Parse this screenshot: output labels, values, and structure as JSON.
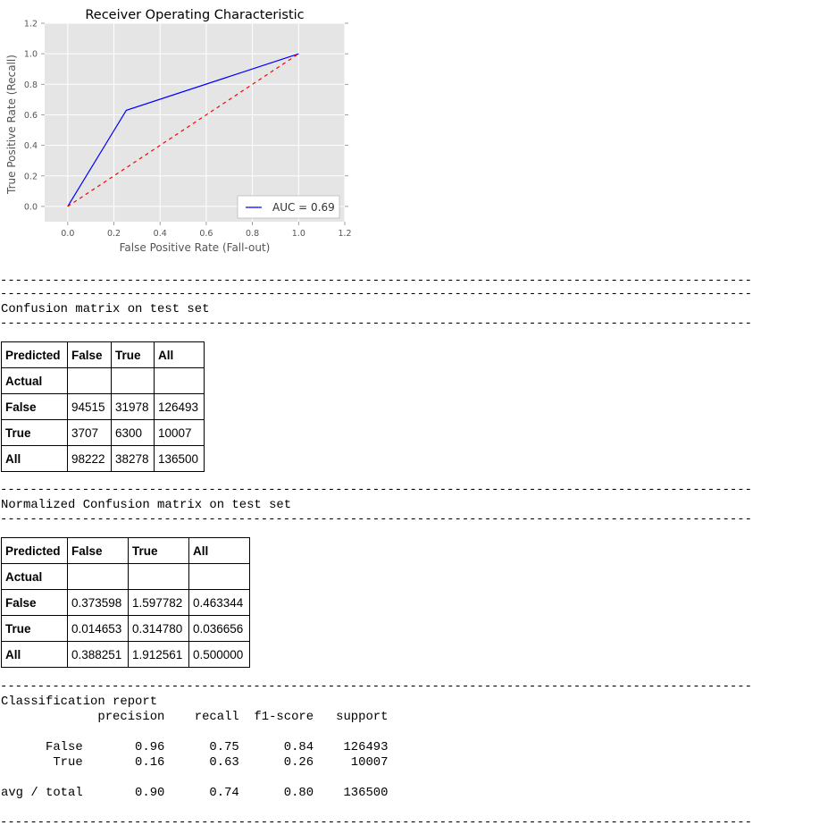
{
  "chart_data": {
    "type": "line",
    "title": "Receiver Operating Characteristic",
    "xlabel": "False Positive Rate (Fall-out)",
    "ylabel": "True Positive Rate (Recall)",
    "xlim": [
      -0.1,
      1.2
    ],
    "ylim": [
      -0.1,
      1.2
    ],
    "xticks": [
      "0.0",
      "0.2",
      "0.4",
      "0.6",
      "0.8",
      "1.0",
      "1.2"
    ],
    "yticks": [
      "0.0",
      "0.2",
      "0.4",
      "0.6",
      "0.8",
      "1.0",
      "1.2"
    ],
    "grid": true,
    "legend_position": "lower right",
    "series": [
      {
        "name": "AUC = 0.69",
        "color": "#0000ff",
        "style": "solid",
        "x": [
          0.0,
          0.2536,
          1.0
        ],
        "y": [
          0.0,
          0.6296,
          1.0
        ]
      },
      {
        "color": "#ff0000",
        "style": "dashed",
        "x": [
          0.0,
          1.0
        ],
        "y": [
          0.0,
          1.0
        ]
      }
    ],
    "colors": {
      "plot_background": "#e5e5e5",
      "grid": "#ffffff",
      "text": "#555555"
    }
  },
  "output": {
    "separator": "-----------------------------------------------------------------------------------------------------------------------------------------------",
    "cm_heading": "Confusion matrix on test set",
    "ncm_heading": "Normalized Confusion matrix on test set",
    "confusion_matrix": {
      "header": [
        "Predicted",
        "False",
        "True",
        "All"
      ],
      "index_label": "Actual",
      "rows": [
        [
          "False",
          "94515",
          "31978",
          "126493"
        ],
        [
          "True",
          "3707",
          "6300",
          "10007"
        ],
        [
          "All",
          "98222",
          "38278",
          "136500"
        ]
      ]
    },
    "normalized_matrix": {
      "header": [
        "Predicted",
        "False",
        "True",
        "All"
      ],
      "index_label": "Actual",
      "rows": [
        [
          "False",
          "0.373598",
          "1.597782",
          "0.463344"
        ],
        [
          "True",
          "0.014653",
          "0.314780",
          "0.036656"
        ],
        [
          "All",
          "0.388251",
          "1.912561",
          "0.500000"
        ]
      ]
    },
    "report": {
      "heading": "Classification report",
      "header_line": "             precision    recall  f1-score   support",
      "line_false": "      False       0.96      0.75      0.84    126493",
      "line_true": "       True       0.16      0.63      0.26     10007",
      "line_avg": "avg / total       0.90      0.74      0.80    136500"
    }
  }
}
